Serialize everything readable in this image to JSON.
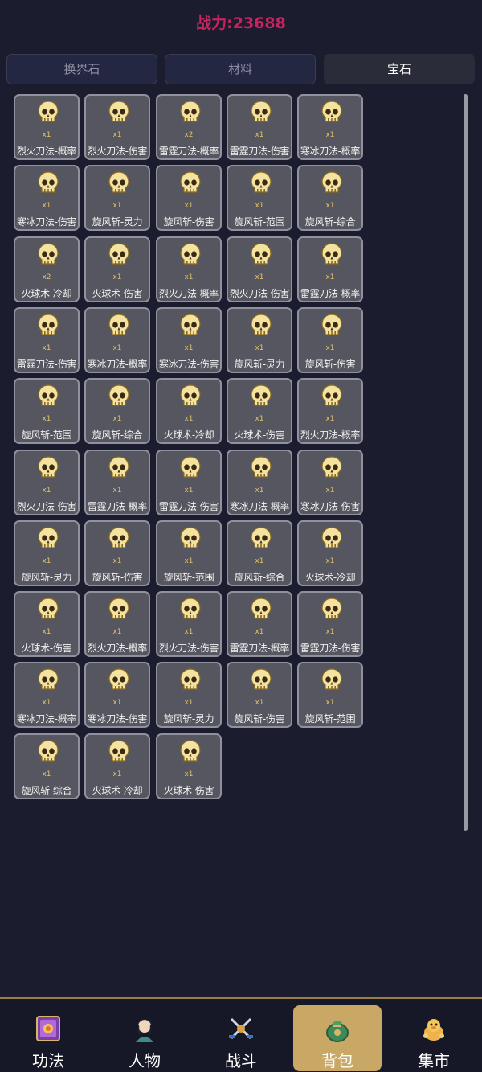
{
  "header": {
    "power_label": "战力:23688"
  },
  "tabs": [
    {
      "label": "换界石",
      "active": false
    },
    {
      "label": "材料",
      "active": false
    },
    {
      "label": "宝石",
      "active": true
    }
  ],
  "items": [
    {
      "name": "烈火刀法-概率",
      "count": "x1"
    },
    {
      "name": "烈火刀法-伤害",
      "count": "x1"
    },
    {
      "name": "雷霆刀法-概率",
      "count": "x2"
    },
    {
      "name": "雷霆刀法-伤害",
      "count": "x1"
    },
    {
      "name": "寒冰刀法-概率",
      "count": "x1"
    },
    {
      "name": "寒冰刀法-伤害",
      "count": "x1"
    },
    {
      "name": "旋风斩-灵力",
      "count": "x1"
    },
    {
      "name": "旋风斩-伤害",
      "count": "x1"
    },
    {
      "name": "旋风斩-范围",
      "count": "x1"
    },
    {
      "name": "旋风斩-综合",
      "count": "x1"
    },
    {
      "name": "火球术-冷却",
      "count": "x2"
    },
    {
      "name": "火球术-伤害",
      "count": "x1"
    },
    {
      "name": "烈火刀法-概率",
      "count": "x1"
    },
    {
      "name": "烈火刀法-伤害",
      "count": "x1"
    },
    {
      "name": "雷霆刀法-概率",
      "count": "x1"
    },
    {
      "name": "雷霆刀法-伤害",
      "count": "x1"
    },
    {
      "name": "寒冰刀法-概率",
      "count": "x1"
    },
    {
      "name": "寒冰刀法-伤害",
      "count": "x1"
    },
    {
      "name": "旋风斩-灵力",
      "count": "x1"
    },
    {
      "name": "旋风斩-伤害",
      "count": "x1"
    },
    {
      "name": "旋风斩-范围",
      "count": "x1"
    },
    {
      "name": "旋风斩-综合",
      "count": "x1"
    },
    {
      "name": "火球术-冷却",
      "count": "x1"
    },
    {
      "name": "火球术-伤害",
      "count": "x1"
    },
    {
      "name": "烈火刀法-概率",
      "count": "x1"
    },
    {
      "name": "烈火刀法-伤害",
      "count": "x1"
    },
    {
      "name": "雷霆刀法-概率",
      "count": "x1"
    },
    {
      "name": "雷霆刀法-伤害",
      "count": "x1"
    },
    {
      "name": "寒冰刀法-概率",
      "count": "x1"
    },
    {
      "name": "寒冰刀法-伤害",
      "count": "x1"
    },
    {
      "name": "旋风斩-灵力",
      "count": "x1"
    },
    {
      "name": "旋风斩-伤害",
      "count": "x1"
    },
    {
      "name": "旋风斩-范围",
      "count": "x1"
    },
    {
      "name": "旋风斩-综合",
      "count": "x1"
    },
    {
      "name": "火球术-冷却",
      "count": "x1"
    },
    {
      "name": "火球术-伤害",
      "count": "x1"
    },
    {
      "name": "烈火刀法-概率",
      "count": "x1"
    },
    {
      "name": "烈火刀法-伤害",
      "count": "x1"
    },
    {
      "name": "雷霆刀法-概率",
      "count": "x1"
    },
    {
      "name": "雷霆刀法-伤害",
      "count": "x1"
    },
    {
      "name": "寒冰刀法-概率",
      "count": "x1"
    },
    {
      "name": "寒冰刀法-伤害",
      "count": "x1"
    },
    {
      "name": "旋风斩-灵力",
      "count": "x1"
    },
    {
      "name": "旋风斩-伤害",
      "count": "x1"
    },
    {
      "name": "旋风斩-范围",
      "count": "x1"
    },
    {
      "name": "旋风斩-综合",
      "count": "x1"
    },
    {
      "name": "火球术-冷却",
      "count": "x1"
    },
    {
      "name": "火球术-伤害",
      "count": "x1"
    }
  ],
  "item_icon": "skull-gem-icon",
  "nav": [
    {
      "label": "功法",
      "icon": "scroll-book-icon",
      "active": false
    },
    {
      "label": "人物",
      "icon": "character-portrait-icon",
      "active": false
    },
    {
      "label": "战斗",
      "icon": "crossed-swords-icon",
      "active": false
    },
    {
      "label": "背包",
      "icon": "bag-icon",
      "active": true
    },
    {
      "label": "集市",
      "icon": "merchant-pig-icon",
      "active": false
    }
  ],
  "colors": {
    "background": "#1b1c2e",
    "power_text": "#c4255e",
    "active_nav": "#c9a865",
    "count_text": "#e3c26a"
  }
}
